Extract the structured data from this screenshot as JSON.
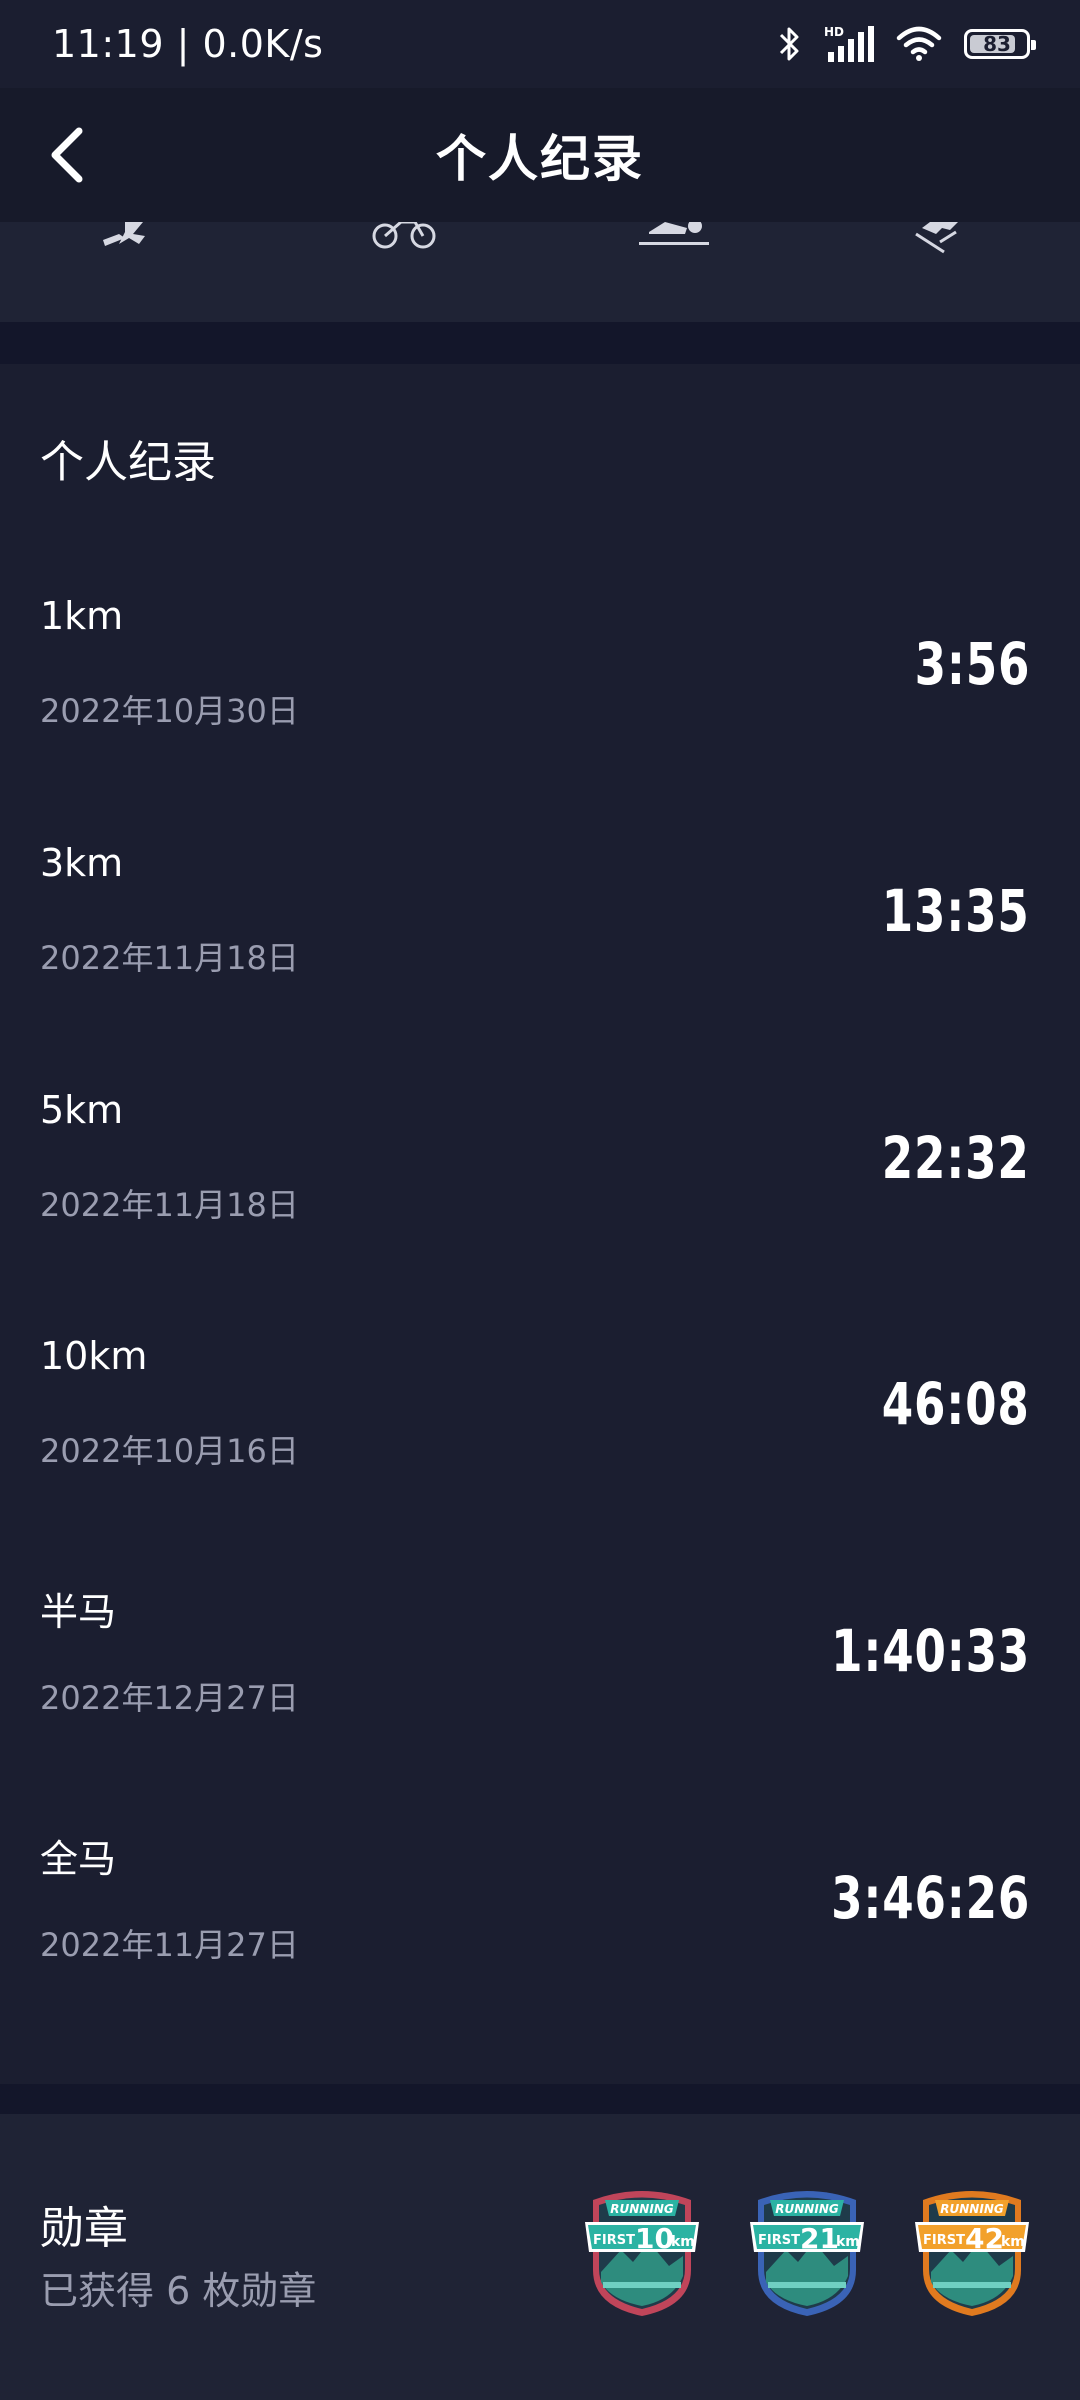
{
  "status_bar": {
    "time_speed": "11:19 | 0.0K/s",
    "battery_level": "83",
    "battery_fraction": 0.83,
    "icons": [
      "bluetooth-icon",
      "signal-hd-icon",
      "wifi-icon",
      "battery-icon"
    ]
  },
  "header": {
    "title": "个人纪录",
    "back_icon": "chevron-left-icon"
  },
  "sport_tabs": [
    {
      "icon": "running-icon"
    },
    {
      "icon": "cycling-icon"
    },
    {
      "icon": "swimming-icon"
    },
    {
      "icon": "skiing-icon"
    }
  ],
  "records": {
    "title": "个人纪录",
    "items": [
      {
        "name": "1km",
        "date": "2022年10月30日",
        "time": "3:56"
      },
      {
        "name": "3km",
        "date": "2022年11月18日",
        "time": "13:35"
      },
      {
        "name": "5km",
        "date": "2022年11月18日",
        "time": "22:32"
      },
      {
        "name": "10km",
        "date": "2022年10月16日",
        "time": "46:08"
      },
      {
        "name": "半马",
        "date": "2022年12月27日",
        "time": "1:40:33"
      },
      {
        "name": "全马",
        "date": "2022年11月27日",
        "time": "3:46:26"
      }
    ]
  },
  "medals": {
    "title": "勋章",
    "count_text": "已获得 6 枚勋章",
    "items": [
      {
        "banner": "RUNNING",
        "prefix": "FIRST",
        "distance": "10",
        "unit": "km",
        "accent": "#2bb3a3",
        "rim": "#c0455a"
      },
      {
        "banner": "RUNNING",
        "prefix": "FIRST",
        "distance": "21",
        "unit": "km",
        "accent": "#2bb3a3",
        "rim": "#3a63b6"
      },
      {
        "banner": "RUNNING",
        "prefix": "FIRST",
        "distance": "42",
        "unit": "km",
        "accent": "#f2a12b",
        "rim": "#e07a1f"
      }
    ]
  },
  "colors": {
    "background": "#1b1e30",
    "header_bg": "#171a2a",
    "secondary_text": "#9a9db0"
  }
}
